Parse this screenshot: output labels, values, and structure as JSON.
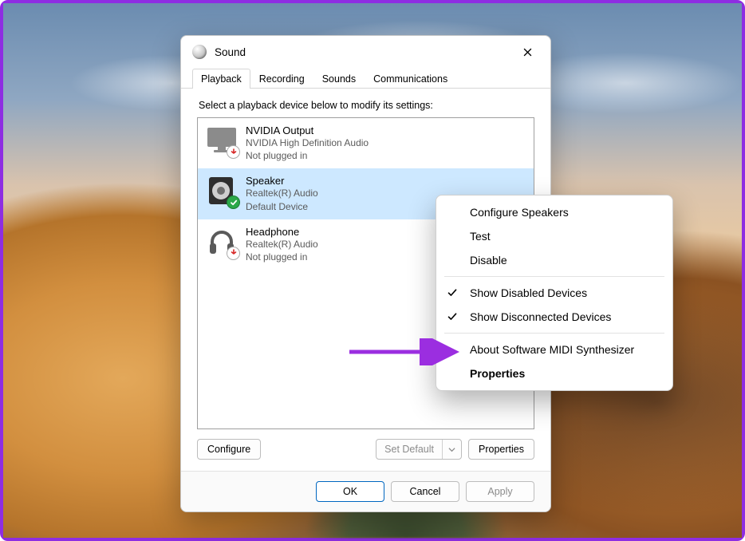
{
  "window": {
    "title": "Sound"
  },
  "tabs": [
    "Playback",
    "Recording",
    "Sounds",
    "Communications"
  ],
  "active_tab_index": 0,
  "instruction": "Select a playback device below to modify its settings:",
  "devices": [
    {
      "name": "NVIDIA Output",
      "subtitle": "NVIDIA High Definition Audio",
      "status": "Not plugged in",
      "icon": "monitor",
      "overlay": "unplugged",
      "selected": false
    },
    {
      "name": "Speaker",
      "subtitle": "Realtek(R) Audio",
      "status": "Default Device",
      "icon": "speaker",
      "overlay": "default",
      "selected": true
    },
    {
      "name": "Headphone",
      "subtitle": "Realtek(R) Audio",
      "status": "Not plugged in",
      "icon": "headphone",
      "overlay": "unplugged",
      "selected": false
    }
  ],
  "bottom_buttons": {
    "configure": "Configure",
    "set_default": "Set Default",
    "properties": "Properties"
  },
  "footer_buttons": {
    "ok": "OK",
    "cancel": "Cancel",
    "apply": "Apply"
  },
  "context_menu": {
    "items": [
      {
        "label": "Configure Speakers",
        "checked": false,
        "bold": false
      },
      {
        "label": "Test",
        "checked": false,
        "bold": false
      },
      {
        "label": "Disable",
        "checked": false,
        "bold": false
      },
      {
        "separator": true
      },
      {
        "label": "Show Disabled Devices",
        "checked": true,
        "bold": false
      },
      {
        "label": "Show Disconnected Devices",
        "checked": true,
        "bold": false
      },
      {
        "separator": true
      },
      {
        "label": "About Software MIDI Synthesizer",
        "checked": false,
        "bold": false
      },
      {
        "label": "Properties",
        "checked": false,
        "bold": true
      }
    ]
  },
  "colors": {
    "selection": "#cde8ff",
    "accent": "#0067c0",
    "annotation": "#9b2ee0",
    "border_frame": "#8e2de2"
  }
}
